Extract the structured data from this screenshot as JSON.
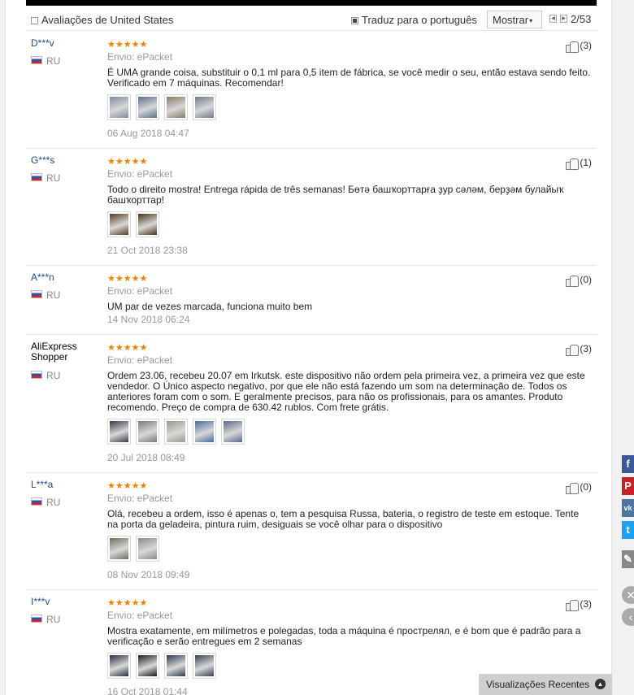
{
  "toolbar": {
    "reviews_from": "Avaliações de United States",
    "translate": "Traduz para o português",
    "show_label": "Mostrar",
    "page": "2/53"
  },
  "reviews": [
    {
      "user": "D***v",
      "country": "RU",
      "stars": "★★★★★",
      "shipping": "Envio: ePacket",
      "text": "É UMA grande coisa, substituir o 0,1 ml para 0,5 item de fábrica, se você medir o seu, então estava sendo feito. Verificado em 7 máquinas. Recomendar!",
      "date": "06 Aug 2018 04:47",
      "helpful": "(3)",
      "photos": 4
    },
    {
      "user": "G***s",
      "country": "RU",
      "stars": "★★★★★",
      "shipping": "Envio: ePacket",
      "text": "Todo o direito mostra! Entrega rápida de três semanas! Бөтә башҡорттарға ҙур сәләм, берҙәм булайыҡ башҡорттар!",
      "date": "21 Oct 2018 23:38",
      "helpful": "(1)",
      "photos": 2
    },
    {
      "user": "A***n",
      "country": "RU",
      "stars": "★★★★★",
      "shipping": "Envio: ePacket",
      "text": "UM par de vezes marcada, funciona muito bem",
      "date": "14 Nov 2018 06:24",
      "helpful": "(0)",
      "photos": 0
    },
    {
      "user": "AliExpress Shopper",
      "country": "RU",
      "stars": "★★★★★",
      "shipping": "Envio: ePacket",
      "text": "Ordem 23.06, recebeu 20.07 em Irkutsk. este dispositivo não ordem pela primeira vez, a primeira vez que este vendedor. O Único aspecto negativo, por que ele não está fazendo um som na determinação de. Todos os anteriores foram com o som. E geralmente precisos, para não os profissionais, para os amantes. Produto recomendo. Preço de compra de 630.42 rublos. Com frete grátis.",
      "date": "20 Jul 2018 08:49",
      "helpful": "(3)",
      "photos": 5
    },
    {
      "user": "L***a",
      "country": "RU",
      "stars": "★★★★★",
      "shipping": "Envio: ePacket",
      "text": "Olá, recebeu a ordem, isso é apenas o, tem a pesquisa Russa, bateria, o registro de teste em estoque. Tente na porta da geladeira, pintura ruim, desiguais se você olhar para o dispositivo",
      "date": "08 Nov 2018 09:49",
      "helpful": "(0)",
      "photos": 2
    },
    {
      "user": "I***v",
      "country": "RU",
      "stars": "★★★★★",
      "shipping": "Envio: ePacket",
      "text": "Mostra exatamente, em milímetros e polegadas, toda a máquina é прострелял, e é bom que é padrão para a verificação e serão entregues em 2 semanas",
      "date": "16 Oct 2018 01:44",
      "helpful": "(3)",
      "photos": 4
    }
  ],
  "share": {
    "facebook": "f",
    "pinterest": "P",
    "vk": "vk",
    "twitter": "t",
    "edit": "✎"
  },
  "recent_views": "Visualizações Recentes",
  "colors": {
    "stars": "#f08200",
    "username": "#1a4a8f",
    "facebook": "#3b5998",
    "pinterest": "#cb2027",
    "vk": "#4c75a3",
    "twitter": "#1da1f2"
  }
}
